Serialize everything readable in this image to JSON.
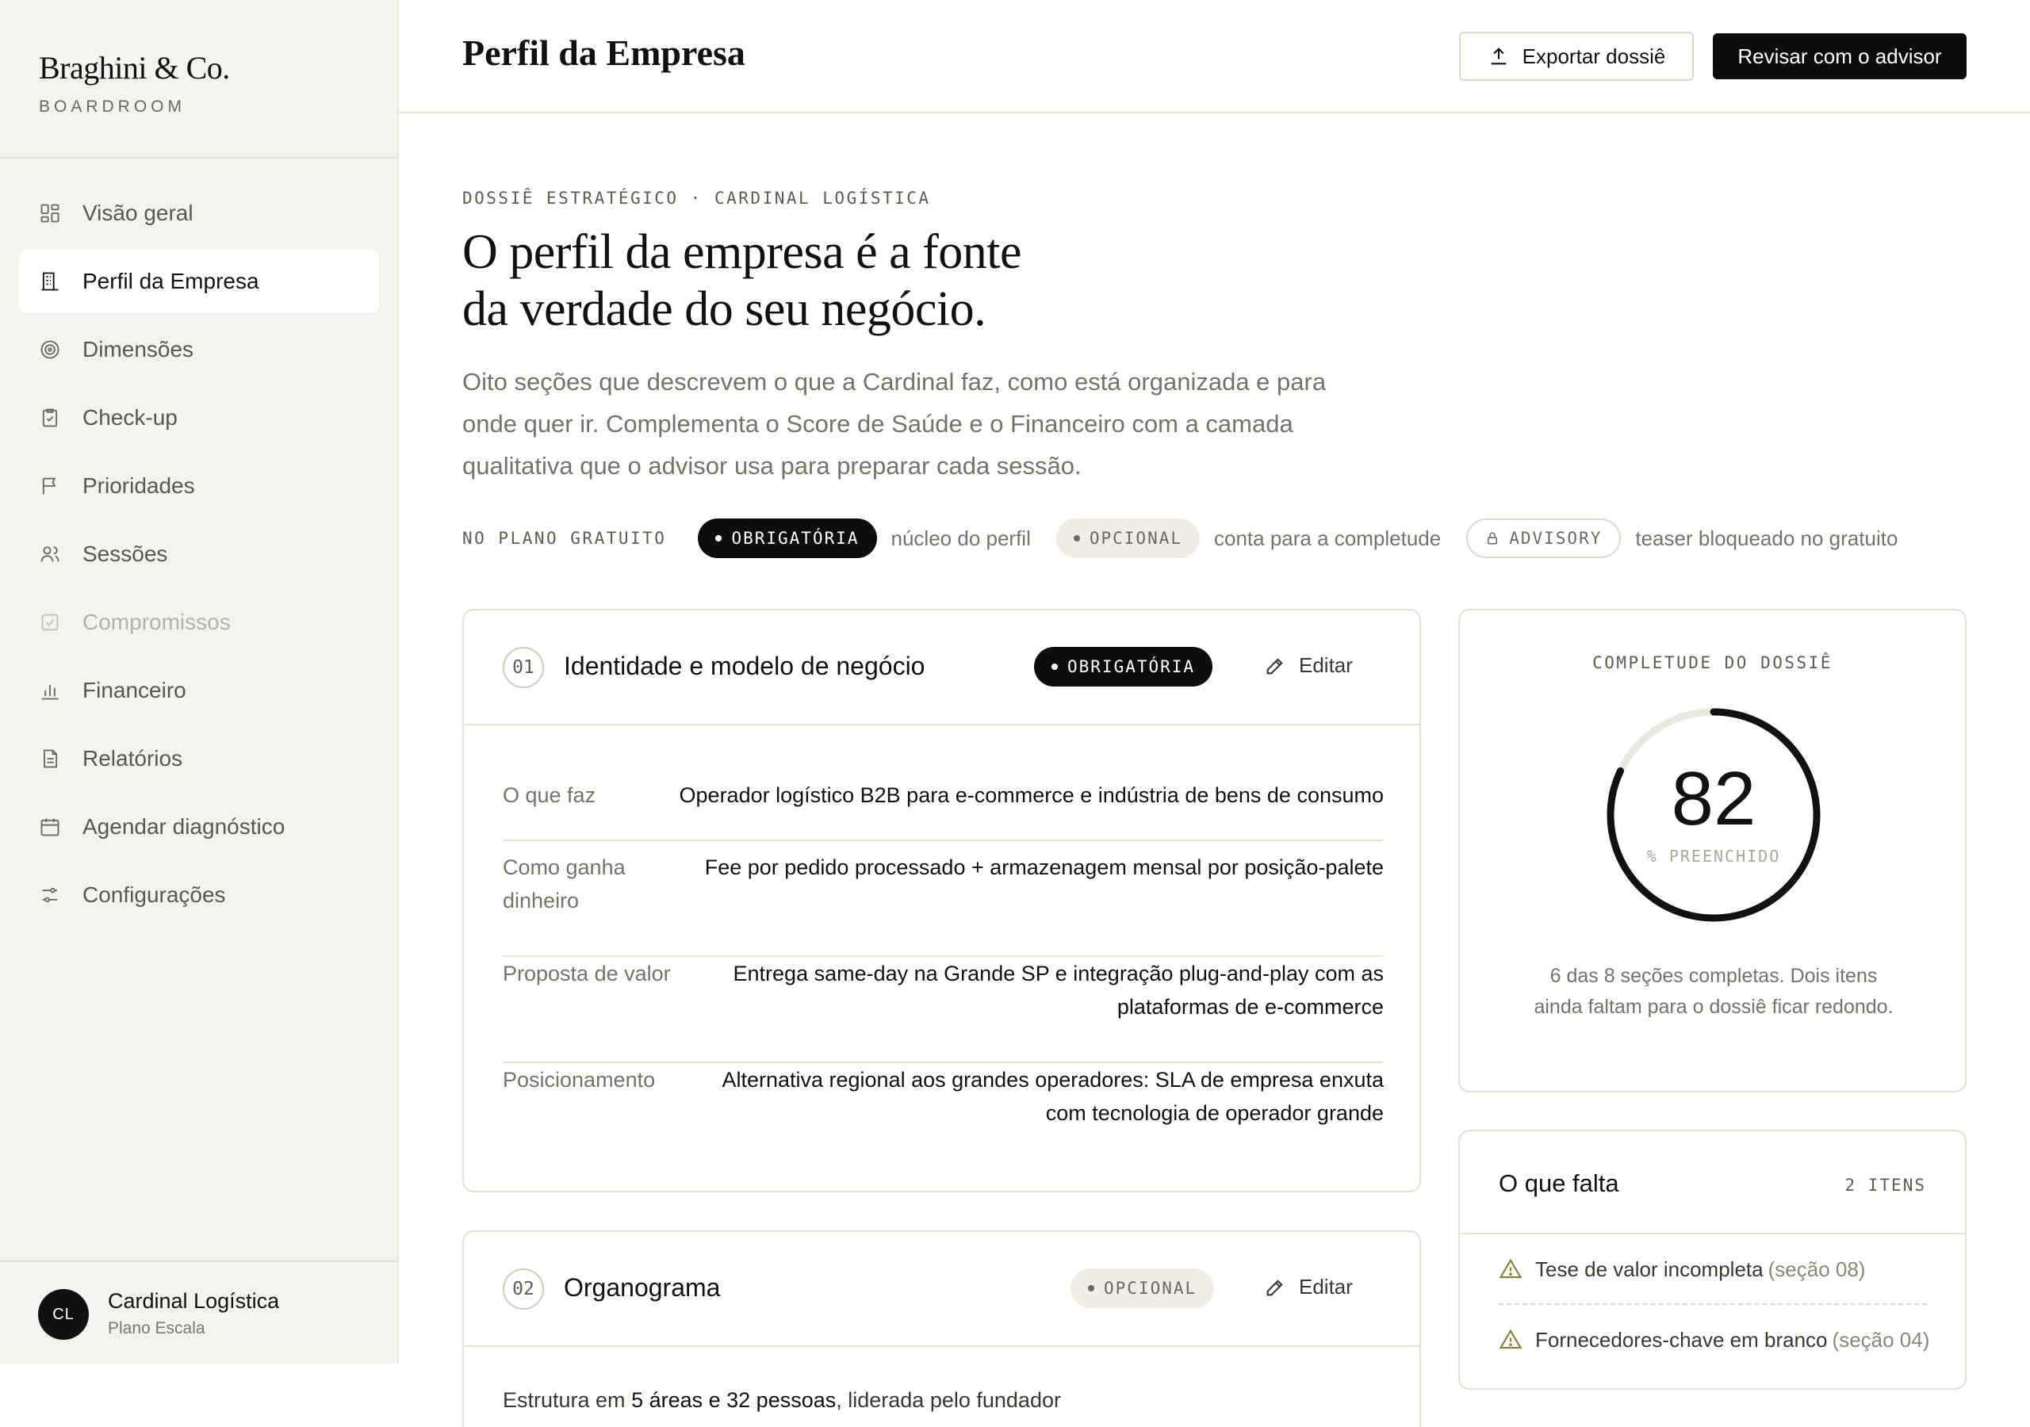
{
  "brand": {
    "name": "Braghini & Co.",
    "subtitle": "BOARDROOM"
  },
  "sidebar": {
    "items": [
      {
        "label": "Visão geral",
        "icon": "grid-icon",
        "state": "normal"
      },
      {
        "label": "Perfil da Empresa",
        "icon": "building-icon",
        "state": "active"
      },
      {
        "label": "Dimensões",
        "icon": "target-icon",
        "state": "normal"
      },
      {
        "label": "Check-up",
        "icon": "clipboard-check-icon",
        "state": "normal"
      },
      {
        "label": "Prioridades",
        "icon": "flag-icon",
        "state": "normal"
      },
      {
        "label": "Sessões",
        "icon": "users-icon",
        "state": "normal"
      },
      {
        "label": "Compromissos",
        "icon": "checkbox-icon",
        "state": "disabled"
      },
      {
        "label": "Financeiro",
        "icon": "bar-chart-icon",
        "state": "normal"
      },
      {
        "label": "Relatórios",
        "icon": "document-icon",
        "state": "normal"
      },
      {
        "label": "Agendar diagnóstico",
        "icon": "calendar-icon",
        "state": "normal"
      },
      {
        "label": "Configurações",
        "icon": "sliders-icon",
        "state": "normal"
      }
    ]
  },
  "user": {
    "initials": "CL",
    "name": "Cardinal Logística",
    "plan": "Plano Escala"
  },
  "header": {
    "title": "Perfil da Empresa",
    "export_label": "Exportar dossiê",
    "advisor_label": "Revisar com o advisor"
  },
  "hero": {
    "kicker": "DOSSIÊ ESTRATÉGICO · CARDINAL LOGÍSTICA",
    "title_line1": "O perfil da empresa é a fonte",
    "title_line2": "da verdade do seu negócio.",
    "description": "Oito seções que descrevem o que a Cardinal faz, como está organizada e para onde quer ir. Complementa o Score de Saúde e o Financeiro com a camada qualitativa que o advisor usa para preparar cada sessão."
  },
  "legend": {
    "label": "NO PLANO GRATUITO",
    "required_pill": "OBRIGATÓRIA",
    "required_text": "núcleo do perfil",
    "optional_pill": "OPCIONAL",
    "optional_text": "conta para a completude",
    "advisory_pill": "ADVISORY",
    "advisory_text": "teaser bloqueado no gratuito"
  },
  "sections": [
    {
      "number": "01",
      "title": "Identidade e modelo de negócio",
      "badge": "OBRIGATÓRIA",
      "edit_label": "Editar",
      "fields": [
        {
          "key": "O que faz",
          "value": "Operador logístico B2B para e-commerce e indústria de bens de consumo"
        },
        {
          "key": "Como ganha dinheiro",
          "value": "Fee por pedido processado + armazenagem mensal por posição-palete"
        },
        {
          "key": "Proposta de valor",
          "value": "Entrega same-day na Grande SP e integração plug-and-play com as plataformas de e-commerce"
        },
        {
          "key": "Posicionamento",
          "value": "Alternativa regional aos grandes operadores: SLA de empresa enxuta com tecnologia de operador grande"
        }
      ]
    },
    {
      "number": "02",
      "title": "Organograma",
      "badge": "OPCIONAL",
      "edit_label": "Editar",
      "summary_prefix": "Estrutura em ",
      "summary_strong": "5 áreas e 32 pessoas",
      "summary_suffix": ", liderada pelo fundador"
    }
  ],
  "completeness": {
    "title": "COMPLETUDE DO DOSSIÊ",
    "value": "82",
    "percent": 82,
    "label": "% PREENCHIDO",
    "description": "6 das 8 seções completas. Dois itens ainda faltam para o dossiê ficar redondo."
  },
  "missing": {
    "title": "O que falta",
    "count": "2 ITENS",
    "items": [
      {
        "text": "Tese de valor incompleta",
        "ref": "(seção 08)"
      },
      {
        "text": "Fornecedores-chave em branco",
        "ref": "(seção 04)"
      }
    ]
  },
  "colors": {
    "accent": "#0d0d0d",
    "sidebar_bg": "#f5f3ee",
    "muted_text": "#76726b",
    "ring_track": "#ebe8e1"
  }
}
